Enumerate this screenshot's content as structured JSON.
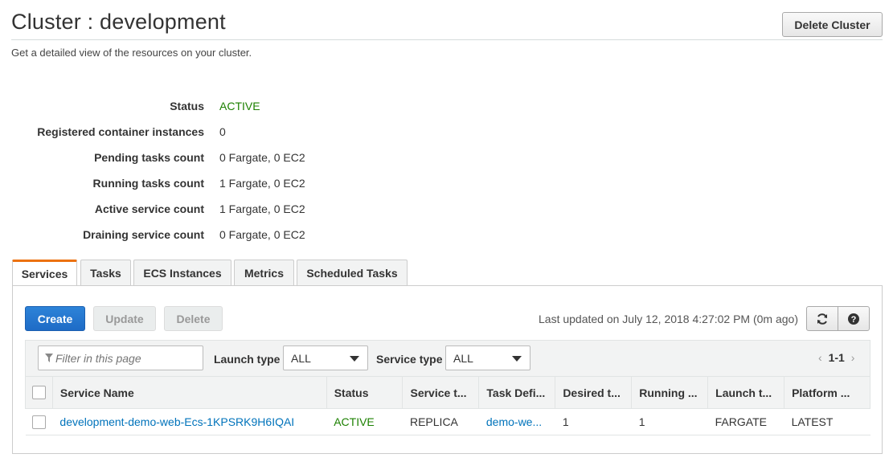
{
  "header": {
    "title": "Cluster : development",
    "subtitle": "Get a detailed view of the resources on your cluster.",
    "delete_cluster_label": "Delete Cluster"
  },
  "details": [
    {
      "label": "Status",
      "value": "ACTIVE"
    },
    {
      "label": "Registered container instances",
      "value": "0"
    },
    {
      "label": "Pending tasks count",
      "value": "0 Fargate, 0 EC2"
    },
    {
      "label": "Running tasks count",
      "value": "1 Fargate, 0 EC2"
    },
    {
      "label": "Active service count",
      "value": "1 Fargate, 0 EC2"
    },
    {
      "label": "Draining service count",
      "value": "0 Fargate, 0 EC2"
    }
  ],
  "tabs": [
    "Services",
    "Tasks",
    "ECS Instances",
    "Metrics",
    "Scheduled Tasks"
  ],
  "active_tab": "Services",
  "toolbar": {
    "create_label": "Create",
    "update_label": "Update",
    "delete_label": "Delete",
    "last_updated": "Last updated on July 12, 2018 4:27:02 PM (0m ago)",
    "refresh_icon": "refresh-icon",
    "help_icon": "help-icon"
  },
  "filters": {
    "search_placeholder": "Filter in this page",
    "launch_type_label": "Launch type",
    "launch_type_value": "ALL",
    "service_type_label": "Service type",
    "service_type_value": "ALL",
    "pager_prev": "‹",
    "pager_range": "1-1",
    "pager_next": "›"
  },
  "table": {
    "columns": [
      "Service Name",
      "Status",
      "Service t...",
      "Task Defi...",
      "Desired t...",
      "Running ...",
      "Launch t...",
      "Platform ..."
    ],
    "rows": [
      [
        "development-demo-web-Ecs-1KPSRK9H6IQAI",
        "ACTIVE",
        "REPLICA",
        "demo-we...",
        "1",
        "1",
        "FARGATE",
        "LATEST"
      ]
    ]
  },
  "colors": {
    "accent": "#ec7211",
    "primary_button": "#1e6bc6",
    "status_active": "#1d8102",
    "link": "#0073bb"
  }
}
